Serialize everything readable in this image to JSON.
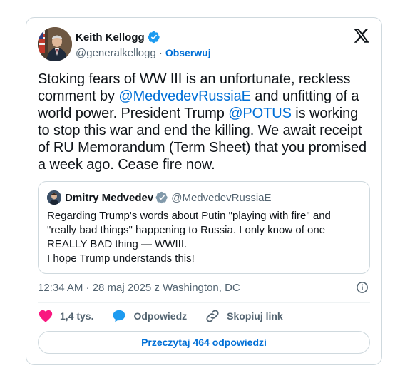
{
  "author": {
    "name": "Keith Kellogg",
    "handle": "@generalkellogg",
    "separator": "·",
    "follow_label": "Obserwuj"
  },
  "tweet": {
    "text_1": "Stoking fears of WW III is an unfortunate, reckless comment by ",
    "mention_1": "@MedvedevRussiaE",
    "text_2": " and unfitting of a world power. President Trump ",
    "mention_2": "@POTUS",
    "text_3": " is working to stop this war and end the killing. We await receipt of RU Memorandum (Term Sheet) that you promised a week ago. Cease fire now."
  },
  "quote": {
    "name": "Dmitry Medvedev",
    "handle": "@MedvedevRussiaE",
    "line_1": "Regarding Trump's words about Putin \"playing with fire\" and",
    "line_2": "\"really bad things\" happening to Russia. I only know of one",
    "line_3": "REALLY BAD thing — WWIII.",
    "line_4": "I hope Trump understands this!"
  },
  "meta": {
    "timestamp": "12:34 AM · 28 maj 2025 z Washington, DC"
  },
  "actions": {
    "likes": "1,4 tys.",
    "reply_label": "Odpowiedz",
    "copy_label": "Skopiuj link"
  },
  "read_replies_label": "Przeczytaj 464 odpowiedzi",
  "colors": {
    "link": "#006fd6",
    "verified": "#1d9bf0",
    "like": "#f91880",
    "muted": "#536471",
    "border": "#cfd9de"
  },
  "icons": {
    "verified": "verified-badge-icon",
    "x_logo": "x-logo-icon",
    "info": "info-icon",
    "heart": "heart-icon",
    "reply": "speech-bubble-icon",
    "link": "link-icon"
  }
}
